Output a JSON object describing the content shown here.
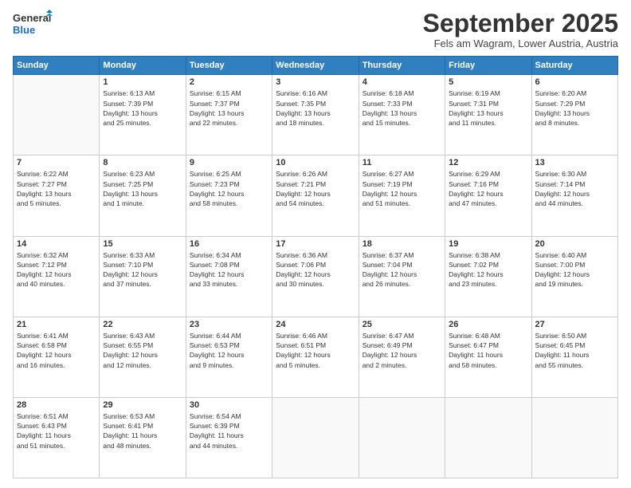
{
  "logo": {
    "line1": "General",
    "line2": "Blue"
  },
  "header": {
    "month": "September 2025",
    "location": "Fels am Wagram, Lower Austria, Austria"
  },
  "days_of_week": [
    "Sunday",
    "Monday",
    "Tuesday",
    "Wednesday",
    "Thursday",
    "Friday",
    "Saturday"
  ],
  "weeks": [
    [
      {
        "day": "",
        "info": ""
      },
      {
        "day": "1",
        "info": "Sunrise: 6:13 AM\nSunset: 7:39 PM\nDaylight: 13 hours\nand 25 minutes."
      },
      {
        "day": "2",
        "info": "Sunrise: 6:15 AM\nSunset: 7:37 PM\nDaylight: 13 hours\nand 22 minutes."
      },
      {
        "day": "3",
        "info": "Sunrise: 6:16 AM\nSunset: 7:35 PM\nDaylight: 13 hours\nand 18 minutes."
      },
      {
        "day": "4",
        "info": "Sunrise: 6:18 AM\nSunset: 7:33 PM\nDaylight: 13 hours\nand 15 minutes."
      },
      {
        "day": "5",
        "info": "Sunrise: 6:19 AM\nSunset: 7:31 PM\nDaylight: 13 hours\nand 11 minutes."
      },
      {
        "day": "6",
        "info": "Sunrise: 6:20 AM\nSunset: 7:29 PM\nDaylight: 13 hours\nand 8 minutes."
      }
    ],
    [
      {
        "day": "7",
        "info": "Sunrise: 6:22 AM\nSunset: 7:27 PM\nDaylight: 13 hours\nand 5 minutes."
      },
      {
        "day": "8",
        "info": "Sunrise: 6:23 AM\nSunset: 7:25 PM\nDaylight: 13 hours\nand 1 minute."
      },
      {
        "day": "9",
        "info": "Sunrise: 6:25 AM\nSunset: 7:23 PM\nDaylight: 12 hours\nand 58 minutes."
      },
      {
        "day": "10",
        "info": "Sunrise: 6:26 AM\nSunset: 7:21 PM\nDaylight: 12 hours\nand 54 minutes."
      },
      {
        "day": "11",
        "info": "Sunrise: 6:27 AM\nSunset: 7:19 PM\nDaylight: 12 hours\nand 51 minutes."
      },
      {
        "day": "12",
        "info": "Sunrise: 6:29 AM\nSunset: 7:16 PM\nDaylight: 12 hours\nand 47 minutes."
      },
      {
        "day": "13",
        "info": "Sunrise: 6:30 AM\nSunset: 7:14 PM\nDaylight: 12 hours\nand 44 minutes."
      }
    ],
    [
      {
        "day": "14",
        "info": "Sunrise: 6:32 AM\nSunset: 7:12 PM\nDaylight: 12 hours\nand 40 minutes."
      },
      {
        "day": "15",
        "info": "Sunrise: 6:33 AM\nSunset: 7:10 PM\nDaylight: 12 hours\nand 37 minutes."
      },
      {
        "day": "16",
        "info": "Sunrise: 6:34 AM\nSunset: 7:08 PM\nDaylight: 12 hours\nand 33 minutes."
      },
      {
        "day": "17",
        "info": "Sunrise: 6:36 AM\nSunset: 7:06 PM\nDaylight: 12 hours\nand 30 minutes."
      },
      {
        "day": "18",
        "info": "Sunrise: 6:37 AM\nSunset: 7:04 PM\nDaylight: 12 hours\nand 26 minutes."
      },
      {
        "day": "19",
        "info": "Sunrise: 6:38 AM\nSunset: 7:02 PM\nDaylight: 12 hours\nand 23 minutes."
      },
      {
        "day": "20",
        "info": "Sunrise: 6:40 AM\nSunset: 7:00 PM\nDaylight: 12 hours\nand 19 minutes."
      }
    ],
    [
      {
        "day": "21",
        "info": "Sunrise: 6:41 AM\nSunset: 6:58 PM\nDaylight: 12 hours\nand 16 minutes."
      },
      {
        "day": "22",
        "info": "Sunrise: 6:43 AM\nSunset: 6:55 PM\nDaylight: 12 hours\nand 12 minutes."
      },
      {
        "day": "23",
        "info": "Sunrise: 6:44 AM\nSunset: 6:53 PM\nDaylight: 12 hours\nand 9 minutes."
      },
      {
        "day": "24",
        "info": "Sunrise: 6:46 AM\nSunset: 6:51 PM\nDaylight: 12 hours\nand 5 minutes."
      },
      {
        "day": "25",
        "info": "Sunrise: 6:47 AM\nSunset: 6:49 PM\nDaylight: 12 hours\nand 2 minutes."
      },
      {
        "day": "26",
        "info": "Sunrise: 6:48 AM\nSunset: 6:47 PM\nDaylight: 11 hours\nand 58 minutes."
      },
      {
        "day": "27",
        "info": "Sunrise: 6:50 AM\nSunset: 6:45 PM\nDaylight: 11 hours\nand 55 minutes."
      }
    ],
    [
      {
        "day": "28",
        "info": "Sunrise: 6:51 AM\nSunset: 6:43 PM\nDaylight: 11 hours\nand 51 minutes."
      },
      {
        "day": "29",
        "info": "Sunrise: 6:53 AM\nSunset: 6:41 PM\nDaylight: 11 hours\nand 48 minutes."
      },
      {
        "day": "30",
        "info": "Sunrise: 6:54 AM\nSunset: 6:39 PM\nDaylight: 11 hours\nand 44 minutes."
      },
      {
        "day": "",
        "info": ""
      },
      {
        "day": "",
        "info": ""
      },
      {
        "day": "",
        "info": ""
      },
      {
        "day": "",
        "info": ""
      }
    ]
  ]
}
